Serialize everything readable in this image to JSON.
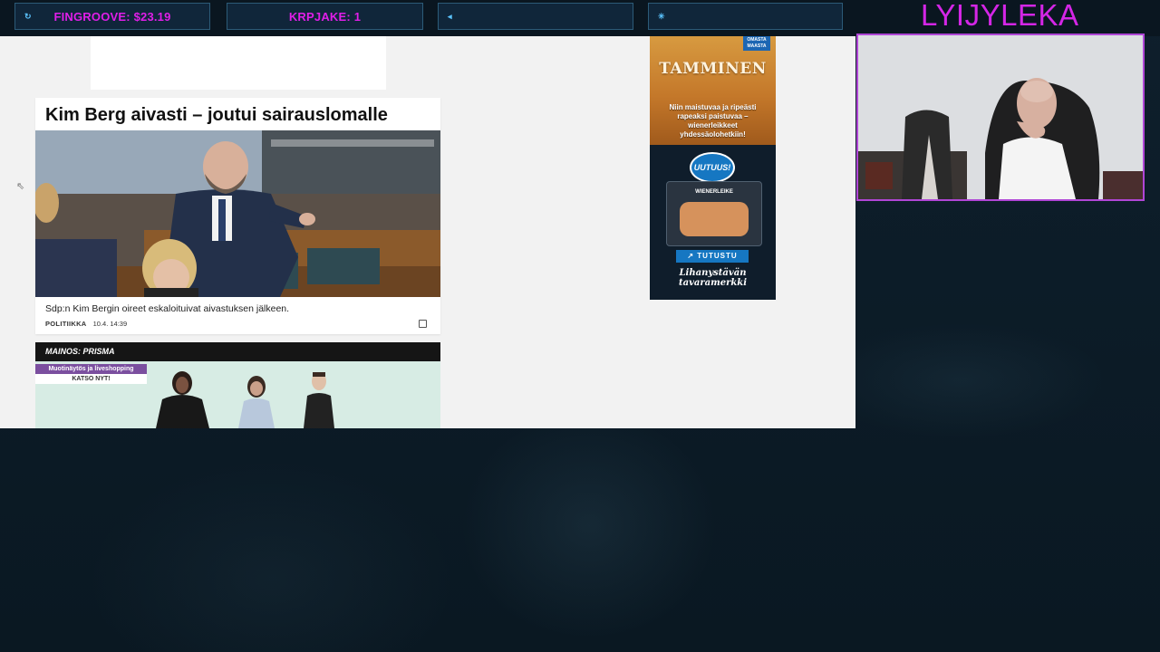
{
  "stream": {
    "widgets": [
      {
        "icon": "refresh-icon",
        "text": "FINGROOVE: $23.19"
      },
      {
        "icon": "",
        "text": "KRPJAKE: 1"
      },
      {
        "icon": "arrow-icon",
        "text": ""
      },
      {
        "icon": "star-icon",
        "text": ""
      }
    ],
    "channel_name": "LYIJYLEKA"
  },
  "article": {
    "headline": "Kim Berg aivasti – joutui sairauslomalle",
    "lead": "Sdp:n Kim Bergin oireet eskaloituivat aivastuksen jälkeen.",
    "category": "POLITIIKKA",
    "timestamp": "10.4. 14:39"
  },
  "promo": {
    "bar_label": "MAINOS: PRISMA",
    "badge_title": "Muotinäytös ja liveshopping",
    "badge_cta": "KATSO NYT!"
  },
  "side_ad": {
    "badge": "OMASTA MAASTA",
    "brand": "TAMMINEN",
    "slogan": "Niin maistuvaa ja ripeästi rapeaksi paistuvaa – wienerleikkeet yhdessäolohetkiin!",
    "new_badge": "UUTUUS!",
    "package_label": "WIENERLEIKE",
    "cta": "TUTUSTU",
    "tagline": "Lihanystävän tavaramerkki"
  },
  "colors": {
    "accent": "#e01ee8",
    "widget_border": "#2c5b78",
    "webcam_border": "#b046d6",
    "ad_blue": "#1677c2"
  }
}
